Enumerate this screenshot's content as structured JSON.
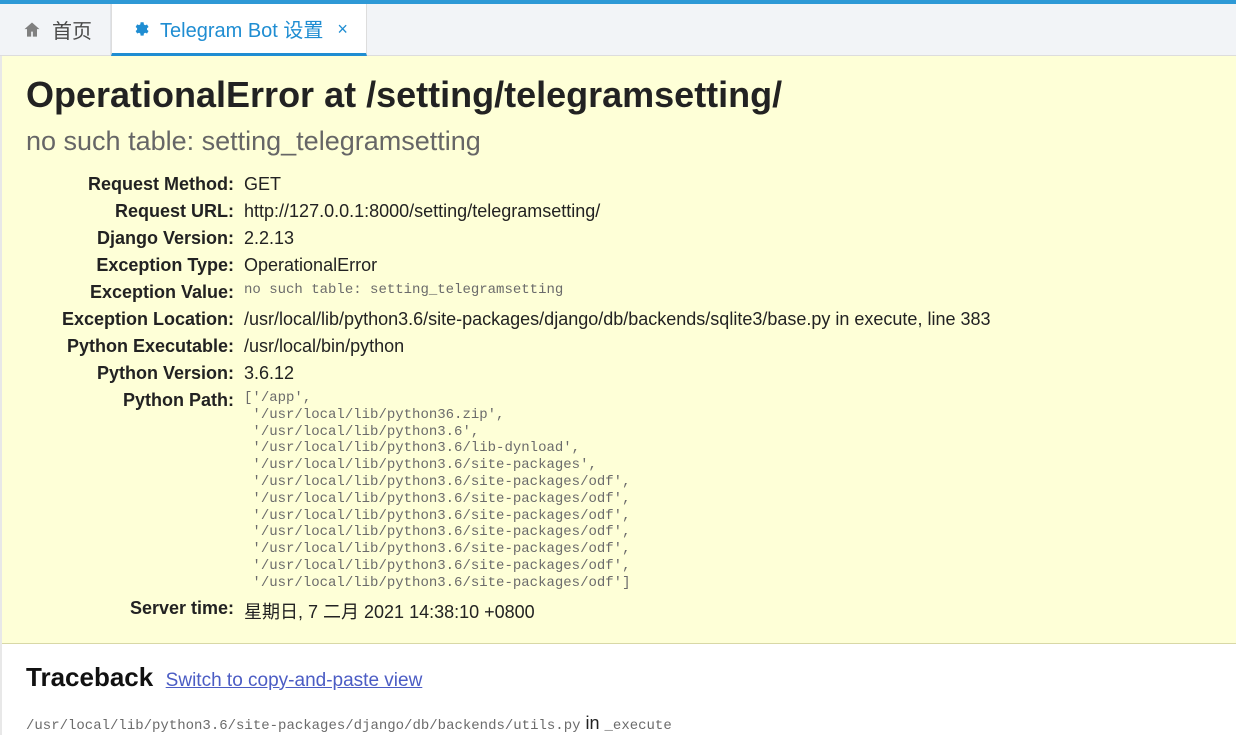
{
  "tabs": {
    "home": {
      "label": "首页"
    },
    "active": {
      "label": "Telegram Bot 设置"
    }
  },
  "error": {
    "title": "OperationalError at /setting/telegramsetting/",
    "subtitle": "no such table: setting_telegramsetting"
  },
  "meta": {
    "request_method": {
      "label": "Request Method:",
      "value": "GET"
    },
    "request_url": {
      "label": "Request URL:",
      "value": "http://127.0.0.1:8000/setting/telegramsetting/"
    },
    "django_version": {
      "label": "Django Version:",
      "value": "2.2.13"
    },
    "exception_type": {
      "label": "Exception Type:",
      "value": "OperationalError"
    },
    "exception_value": {
      "label": "Exception Value:",
      "value": "no such table: setting_telegramsetting"
    },
    "exception_location": {
      "label": "Exception Location:",
      "value": "/usr/local/lib/python3.6/site-packages/django/db/backends/sqlite3/base.py in execute, line 383"
    },
    "python_executable": {
      "label": "Python Executable:",
      "value": "/usr/local/bin/python"
    },
    "python_version": {
      "label": "Python Version:",
      "value": "3.6.12"
    },
    "python_path": {
      "label": "Python Path:",
      "value": "['/app',\n '/usr/local/lib/python36.zip',\n '/usr/local/lib/python3.6',\n '/usr/local/lib/python3.6/lib-dynload',\n '/usr/local/lib/python3.6/site-packages',\n '/usr/local/lib/python3.6/site-packages/odf',\n '/usr/local/lib/python3.6/site-packages/odf',\n '/usr/local/lib/python3.6/site-packages/odf',\n '/usr/local/lib/python3.6/site-packages/odf',\n '/usr/local/lib/python3.6/site-packages/odf',\n '/usr/local/lib/python3.6/site-packages/odf',\n '/usr/local/lib/python3.6/site-packages/odf']"
    },
    "server_time": {
      "label": "Server time:",
      "value": "星期日, 7 二月 2021 14:38:10 +0800"
    }
  },
  "traceback": {
    "heading": "Traceback",
    "switch_label": "Switch to copy-and-paste view",
    "entry": {
      "path": "/usr/local/lib/python3.6/site-packages/django/db/backends/utils.py",
      "in_word": " in ",
      "fn": "_execute"
    }
  }
}
